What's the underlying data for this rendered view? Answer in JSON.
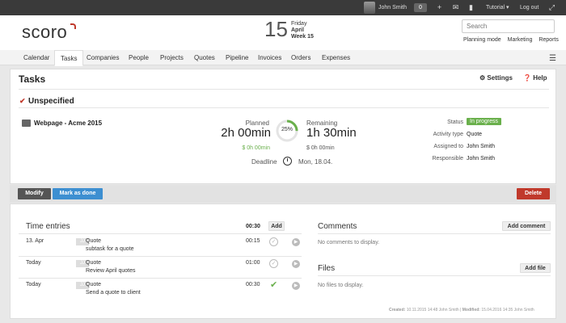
{
  "topbar": {
    "user_name": "John Smith",
    "count": "0",
    "tutorial": "Tutorial",
    "logout": "Log out"
  },
  "header": {
    "logo": "scoro",
    "day": "15",
    "weekday": "Friday",
    "month": "April",
    "week": "Week 15",
    "search_placeholder": "Search",
    "quicklinks": [
      "Planning mode",
      "Marketing",
      "Reports"
    ]
  },
  "nav": {
    "tabs": [
      "Calendar",
      "Tasks",
      "Companies",
      "People",
      "Projects",
      "Quotes",
      "Pipeline",
      "Invoices",
      "Orders",
      "Expenses"
    ],
    "active": "Tasks"
  },
  "task": {
    "page_title": "Tasks",
    "settings_label": "Settings",
    "help_label": "Help",
    "section": "Unspecified",
    "name": "Webpage - Acme 2015",
    "planned_label": "Planned",
    "planned_value": "2h 00min",
    "planned_cost": "$ 0h 00min",
    "progress_percent": 25,
    "progress_label": "25%",
    "remaining_label": "Remaining",
    "remaining_value": "1h 30min",
    "remaining_cost": "$ 0h 00min",
    "deadline_label": "Deadline",
    "deadline_value": "Mon, 18.04.",
    "status_label": "Status",
    "status_value": "In progress",
    "activity_label": "Activity type",
    "activity_value": "Quote",
    "assigned_label": "Assigned to",
    "assigned_value": "John Smith",
    "responsible_label": "Responsible",
    "responsible_value": "John Smith"
  },
  "actions": {
    "modify": "Modify",
    "mark_done": "Mark as done",
    "delete": "Delete"
  },
  "time_entries": {
    "title": "Time entries",
    "total": "00:30",
    "add_label": "Add",
    "rows": [
      {
        "date": "13. Apr",
        "user": "JJ",
        "type": "Quote",
        "desc": "subtask for a quote",
        "time": "00:15",
        "done": false
      },
      {
        "date": "Today",
        "user": "JJ",
        "type": "Quote",
        "desc": "Review April quotes",
        "time": "01:00",
        "done": false
      },
      {
        "date": "Today",
        "user": "JJ",
        "type": "Quote",
        "desc": "Send a quote to client",
        "time": "00:30",
        "done": true
      }
    ]
  },
  "comments": {
    "title": "Comments",
    "add_label": "Add comment",
    "empty": "No comments to display."
  },
  "files": {
    "title": "Files",
    "add_label": "Add file",
    "empty": "No files to display."
  },
  "meta": {
    "created_label": "Created:",
    "created_value": "10.11.2015 14:48 John Smith",
    "modified_label": "Modified:",
    "modified_value": "15.04.2016 14:35 John Smith"
  },
  "colors": {
    "accent_green": "#6ab04c",
    "button_dark": "#555555",
    "button_blue": "#3d8fd1",
    "button_red": "#c0392b"
  }
}
